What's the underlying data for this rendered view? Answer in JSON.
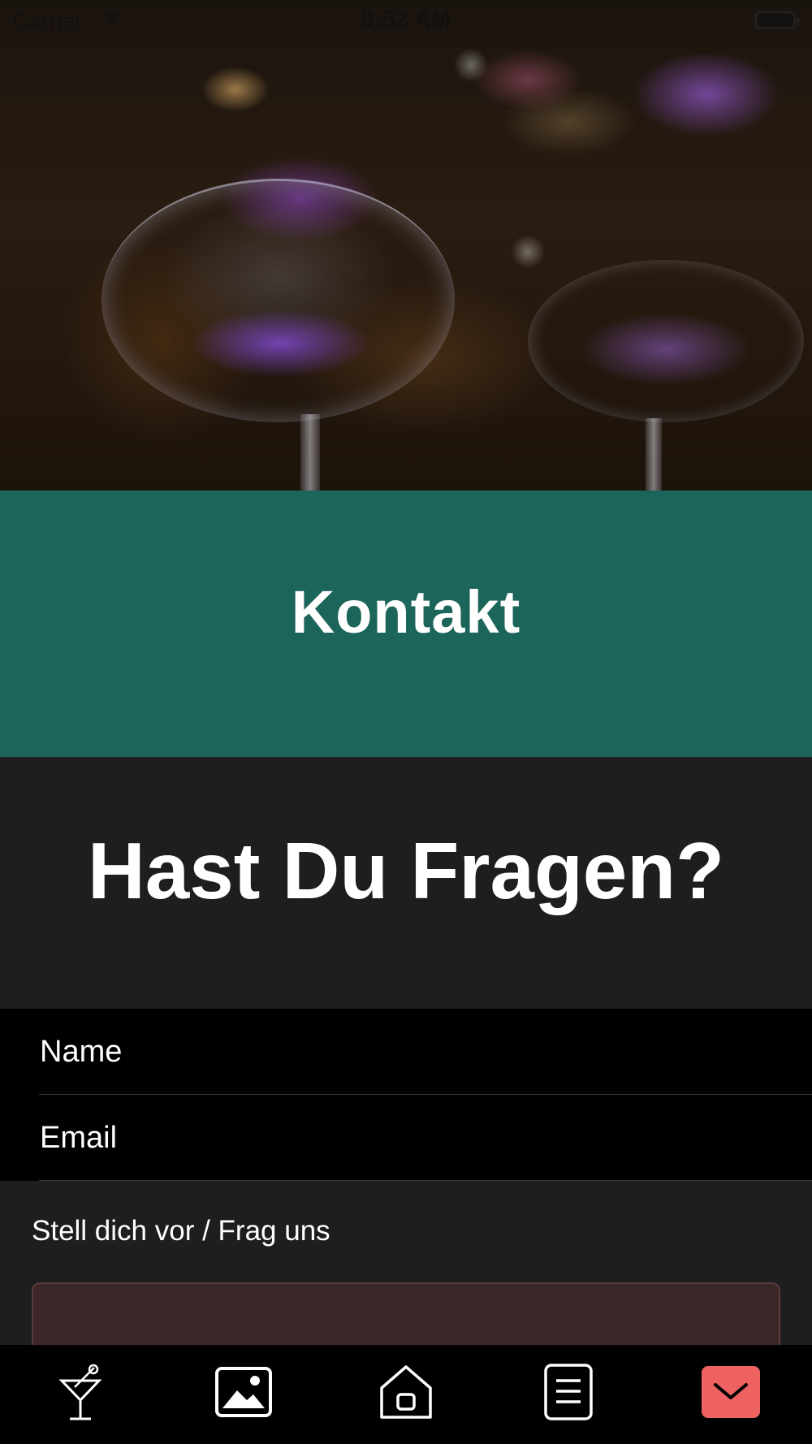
{
  "status_bar": {
    "carrier": "Carrier",
    "time": "9:52 AM"
  },
  "hero": {
    "image": "cocktail-glasses-photo"
  },
  "banner": {
    "title": "Kontakt",
    "color": "#1c655a"
  },
  "question": {
    "title": "Hast Du Fragen?"
  },
  "form": {
    "name_placeholder": "Name",
    "email_placeholder": "Email",
    "message_label": "Stell dich vor / Frag uns",
    "message_box_color": "#3b2728"
  },
  "tab_bar": {
    "items": [
      {
        "icon": "cocktail-icon",
        "active": false
      },
      {
        "icon": "gallery-icon",
        "active": false
      },
      {
        "icon": "home-icon",
        "active": false
      },
      {
        "icon": "menu-list-icon",
        "active": false
      },
      {
        "icon": "mail-icon",
        "active": true
      }
    ],
    "active_color": "#ee6262"
  }
}
